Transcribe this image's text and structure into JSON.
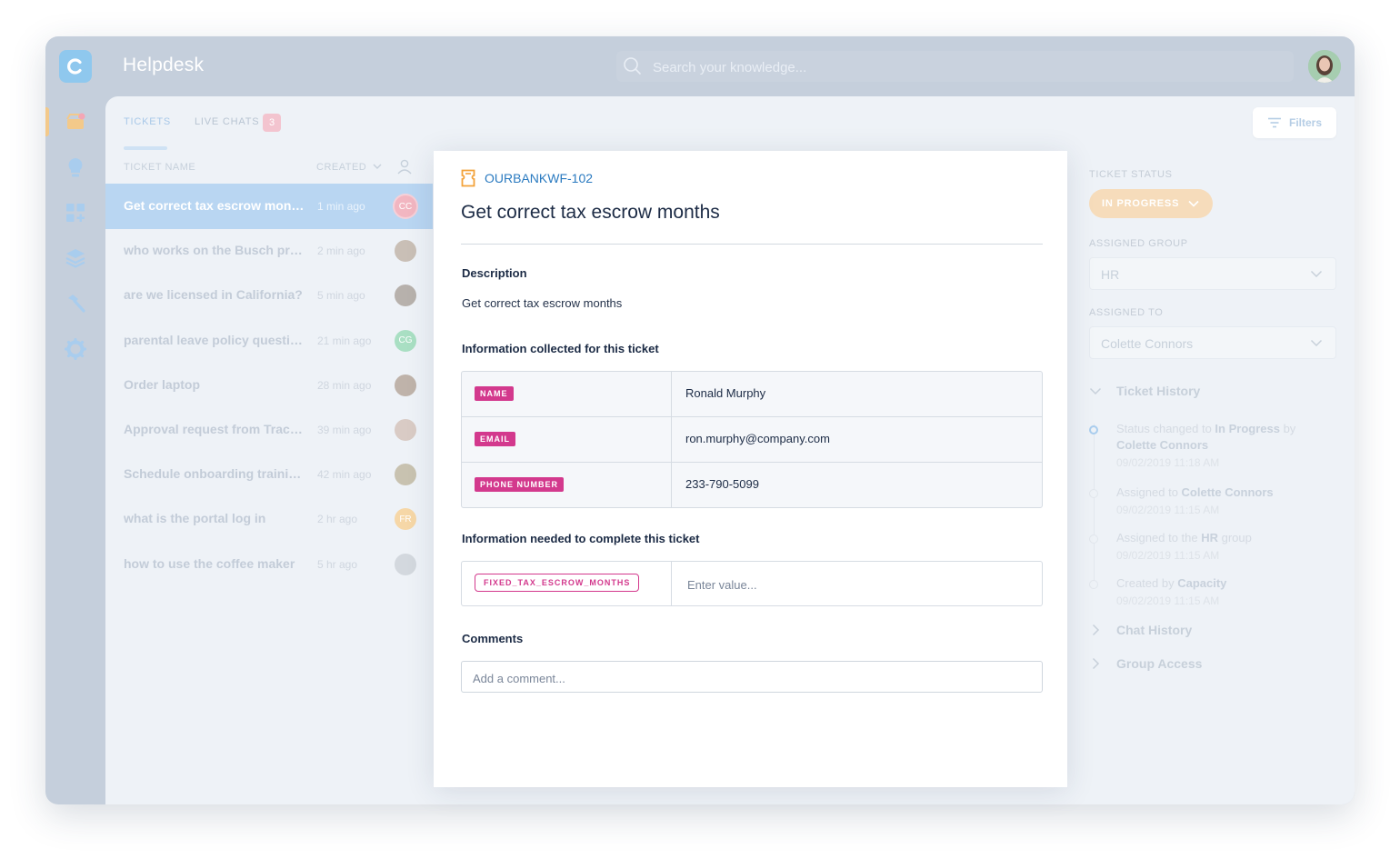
{
  "app": {
    "title": "Helpdesk",
    "logo_letter": "C"
  },
  "search": {
    "placeholder": "Search your knowledge..."
  },
  "tabs": [
    {
      "label": "TICKETS"
    },
    {
      "label": "LIVE CHATS",
      "badge": "3"
    }
  ],
  "filters_label": "Filters",
  "list_header": {
    "name": "TICKET NAME",
    "created": "CREATED"
  },
  "tickets": [
    {
      "name": "Get correct tax escrow months",
      "time": "1 min ago",
      "initials": "CC",
      "color": "#f2b6c1",
      "selected": true
    },
    {
      "name": "who works on the Busch proj...",
      "time": "2 min ago",
      "initials": "",
      "color": "#c9bfb6"
    },
    {
      "name": "are we licensed in California?",
      "time": "5 min ago",
      "initials": "",
      "color": "#b7b1ac"
    },
    {
      "name": "parental leave policy questio...",
      "time": "21 min ago",
      "initials": "CG",
      "color": "#a9dfc3"
    },
    {
      "name": "Order laptop",
      "time": "28 min ago",
      "initials": "",
      "color": "#bfb3aa"
    },
    {
      "name": "Approval request from Tracy...",
      "time": "39 min ago",
      "initials": "",
      "color": "#d9cbc5"
    },
    {
      "name": "Schedule onboarding trainin...",
      "time": "42 min ago",
      "initials": "",
      "color": "#c8c2b0"
    },
    {
      "name": "what is the portal log in",
      "time": "2 hr ago",
      "initials": "FR",
      "color": "#f6d7a7"
    },
    {
      "name": "how to use the coffee maker",
      "time": "5 hr ago",
      "initials": "",
      "color": "#d3d8de"
    }
  ],
  "ticket": {
    "id": "OURBANKWF-102",
    "title": "Get correct tax escrow months",
    "description_label": "Description",
    "description": "Get correct tax escrow months",
    "collected_label": "Information collected for this ticket",
    "collected": [
      {
        "key": "NAME",
        "value": "Ronald Murphy"
      },
      {
        "key": "EMAIL",
        "value": "ron.murphy@company.com"
      },
      {
        "key": "PHONE NUMBER",
        "value": "233-790-5099"
      }
    ],
    "needed_label": "Information needed to complete this ticket",
    "needed": {
      "key": "FIXED_TAX_ESCROW_MONTHS",
      "placeholder": "Enter value..."
    },
    "comments_label": "Comments",
    "comment_placeholder": "Add a comment..."
  },
  "sidebar": {
    "status_label": "TICKET STATUS",
    "status_value": "IN PROGRESS",
    "group_label": "ASSIGNED GROUP",
    "group_value": "HR",
    "assigned_label": "ASSIGNED TO",
    "assigned_value": "Colette Connors",
    "history_title": "Ticket History",
    "history": [
      {
        "pre": "Status changed to ",
        "bold": "In Progress",
        "post": " by ",
        "bold2": "Colette Connors",
        "date": "09/02/2019  11:18 AM"
      },
      {
        "pre": "Assigned to ",
        "bold": "Colette Connors",
        "post": "",
        "bold2": "",
        "date": "09/02/2019  11:15 AM"
      },
      {
        "pre": "Assigned to the ",
        "bold": "HR",
        "post": " group",
        "bold2": "",
        "date": "09/02/2019  11:15 AM"
      },
      {
        "pre": "Created by ",
        "bold": "Capacity",
        "post": "",
        "bold2": "",
        "date": "09/02/2019  11:15 AM"
      }
    ],
    "chat_history": "Chat History",
    "group_access": "Group Access"
  },
  "colors": {
    "accent_blue": "#2a7ac0",
    "tag_pink": "#d3398d",
    "dark_text": "#1c2b45"
  }
}
